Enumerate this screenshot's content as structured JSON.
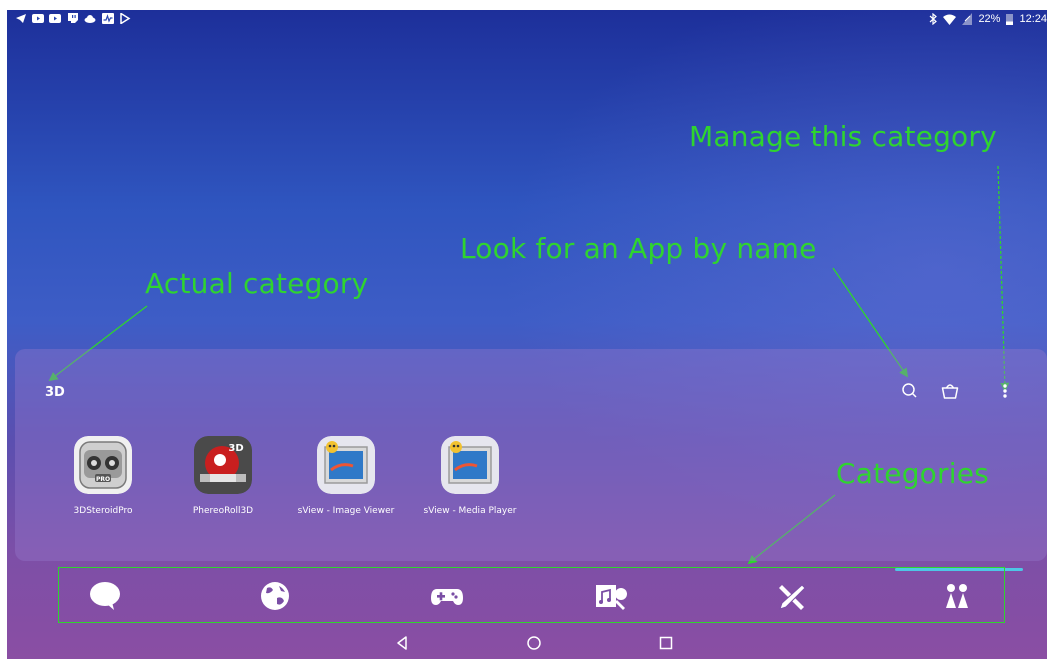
{
  "status_bar": {
    "notification_icons": [
      "telegram-icon",
      "youtube-icon",
      "youtube-icon",
      "twitch-icon",
      "cloud-icon",
      "activity-icon",
      "play-store-icon"
    ],
    "battery_percent": "22%",
    "time": "12:24",
    "status_icons": [
      "bluetooth-icon",
      "wifi-icon",
      "no-sim-icon",
      "battery-icon"
    ]
  },
  "annotations": {
    "manage": "Manage this category",
    "search": "Look for an App by name",
    "category": "Actual category",
    "categories": "Categories"
  },
  "drawer": {
    "category_title": "3D",
    "toolbar": [
      "search-icon",
      "shopping-bag-icon",
      "more-vert-icon"
    ],
    "apps": [
      {
        "label": "3DSteroidPro",
        "icon": "remote-controller-icon"
      },
      {
        "label": "PhereoRoll3D",
        "icon": "phereoroll-icon"
      },
      {
        "label": "sView - Image Viewer",
        "icon": "sview-icon"
      },
      {
        "label": "sView - Media Player",
        "icon": "sview-icon"
      }
    ]
  },
  "categories": [
    {
      "name": "chat-icon"
    },
    {
      "name": "globe-icon"
    },
    {
      "name": "gamepad-icon"
    },
    {
      "name": "multimedia-icon"
    },
    {
      "name": "tools-icon"
    },
    {
      "name": "people-icon",
      "active": true
    }
  ],
  "nav": [
    "back-icon",
    "home-icon",
    "recents-icon"
  ],
  "colors": {
    "annotation": "#2fd42f",
    "active_indicator": "#4ec6e6"
  }
}
